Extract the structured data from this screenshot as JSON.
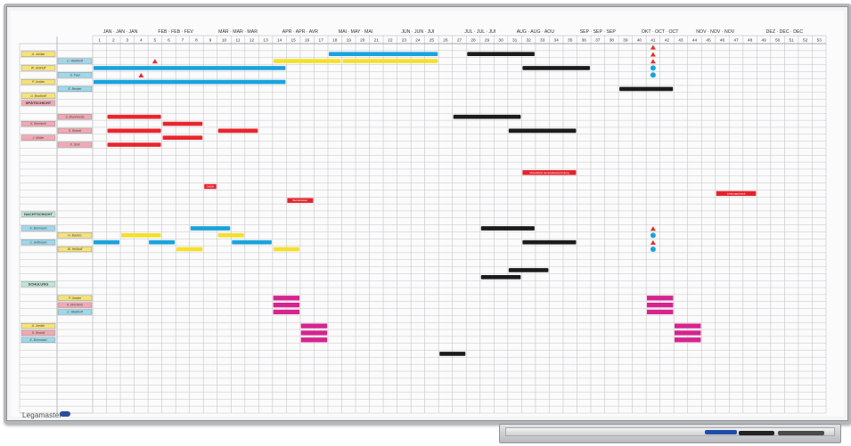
{
  "board": {
    "brand": "Legamaster",
    "frame_color": "#b5b7ba",
    "grid_color": "#c4c6c9",
    "text_color": "#333333"
  },
  "months": [
    "JAN · JAN · JAN",
    "FEB · FEB · FEV",
    "MÄR · MAR · MAR",
    "APR · APR · AVR",
    "MAI · MAY · MAI",
    "JUN · JUN · JUI",
    "JUL · JUL · JUI",
    "AUG · AUG · AOU",
    "SEP · SEP · SEP",
    "OKT · OCT · OCT",
    "NOV · NOV · NOV",
    "DEZ · DEC · DEC"
  ],
  "weeks": [
    "1",
    "2",
    "3",
    "4",
    "5",
    "6",
    "7",
    "8",
    "9",
    "10",
    "11",
    "12",
    "13",
    "14",
    "15",
    "16",
    "17",
    "18",
    "19",
    "20",
    "21",
    "22",
    "23",
    "24",
    "25",
    "26",
    "27",
    "28",
    "29",
    "30",
    "31",
    "32",
    "33",
    "34",
    "35",
    "36",
    "37",
    "38",
    "39",
    "40",
    "41",
    "42",
    "43",
    "44",
    "45",
    "46",
    "47",
    "48",
    "49",
    "50",
    "51",
    "52",
    "53"
  ],
  "section_labels": [
    {
      "text": "SPÄTSCHICHT",
      "color": "#f2a9b3",
      "row": 8
    },
    {
      "text": "NACHTSCHICHT",
      "color": "#bfe6d8",
      "row": 24
    },
    {
      "text": "SCHULUNG",
      "color": "#bfe6d8",
      "row": 34
    }
  ],
  "name_cards": [
    {
      "col": 0,
      "row": 1,
      "color": "#f6e27a",
      "text": "A. Jordan"
    },
    {
      "col": 1,
      "row": 2,
      "color": "#9ed8ea",
      "text": "C. Weidhoff"
    },
    {
      "col": 0,
      "row": 3,
      "color": "#f6e27a",
      "text": "W. Hellhoff"
    },
    {
      "col": 1,
      "row": 4,
      "color": "#9ed8ea",
      "text": "S. Paul"
    },
    {
      "col": 0,
      "row": 5,
      "color": "#f6e27a",
      "text": "P. Jordan"
    },
    {
      "col": 1,
      "row": 6,
      "color": "#9ed8ea",
      "text": "E. Bender"
    },
    {
      "col": 0,
      "row": 7,
      "color": "#f6e27a",
      "text": "U. Brodhoff"
    },
    {
      "col": 1,
      "row": 10,
      "color": "#f2a9b3",
      "text": "S. Brannwede"
    },
    {
      "col": 0,
      "row": 11,
      "color": "#f2a9b3",
      "text": "K. Bremmel"
    },
    {
      "col": 1,
      "row": 12,
      "color": "#f2a9b3",
      "text": "S. Brandt"
    },
    {
      "col": 0,
      "row": 13,
      "color": "#f2a9b3",
      "text": "J. Müller"
    },
    {
      "col": 1,
      "row": 14,
      "color": "#f2a9b3",
      "text": "K. Stoll"
    },
    {
      "col": 0,
      "row": 26,
      "color": "#9ed8ea",
      "text": "K. Borrmann"
    },
    {
      "col": 1,
      "row": 27,
      "color": "#f6e27a",
      "text": "H. Backes"
    },
    {
      "col": 0,
      "row": 28,
      "color": "#9ed8ea",
      "text": "C. Hoffmann"
    },
    {
      "col": 1,
      "row": 29,
      "color": "#f6e27a",
      "text": "W. Hellhoff"
    },
    {
      "col": 1,
      "row": 36,
      "color": "#f6e27a",
      "text": "P. Jordan"
    },
    {
      "col": 1,
      "row": 37,
      "color": "#f2a9b3",
      "text": "K. Bremmel"
    },
    {
      "col": 1,
      "row": 38,
      "color": "#9ed8ea",
      "text": "C. Weidhoff"
    },
    {
      "col": 0,
      "row": 40,
      "color": "#f6e27a",
      "text": "A. Jordan"
    },
    {
      "col": 0,
      "row": 41,
      "color": "#f2a9b3",
      "text": "S. Brandt"
    },
    {
      "col": 0,
      "row": 42,
      "color": "#9ed8ea",
      "text": "K. Borrmann"
    }
  ],
  "bars": [
    {
      "row": 1,
      "week_start": 18,
      "week_end": 25,
      "color": "#1aa3dd"
    },
    {
      "row": 1,
      "week_start": 28,
      "week_end": 32,
      "color": "#1b1b1b"
    },
    {
      "row": 2,
      "week_start": 14,
      "week_end": 18,
      "color": "#f5e02a"
    },
    {
      "row": 2,
      "week_start": 19,
      "week_end": 25,
      "color": "#f5e02a"
    },
    {
      "row": 3,
      "week_start": 1,
      "week_end": 14,
      "color": "#1aa3dd"
    },
    {
      "row": 3,
      "week_start": 32,
      "week_end": 36,
      "color": "#1b1b1b"
    },
    {
      "row": 5,
      "week_start": 1,
      "week_end": 14,
      "color": "#1aa3dd"
    },
    {
      "row": 6,
      "week_start": 39,
      "week_end": 42,
      "color": "#1b1b1b"
    },
    {
      "row": 10,
      "week_start": 2,
      "week_end": 5,
      "color": "#e8262e"
    },
    {
      "row": 10,
      "week_start": 27,
      "week_end": 31,
      "color": "#1b1b1b"
    },
    {
      "row": 11,
      "week_start": 6,
      "week_end": 8,
      "color": "#e8262e"
    },
    {
      "row": 12,
      "week_start": 2,
      "week_end": 5,
      "color": "#e8262e"
    },
    {
      "row": 12,
      "week_start": 10,
      "week_end": 12,
      "color": "#e8262e"
    },
    {
      "row": 12,
      "week_start": 31,
      "week_end": 35,
      "color": "#1b1b1b"
    },
    {
      "row": 13,
      "week_start": 6,
      "week_end": 8,
      "color": "#e8262e"
    },
    {
      "row": 14,
      "week_start": 2,
      "week_end": 5,
      "color": "#e8262e"
    },
    {
      "row": 26,
      "week_start": 8,
      "week_end": 10,
      "color": "#1aa3dd"
    },
    {
      "row": 26,
      "week_start": 29,
      "week_end": 32,
      "color": "#1b1b1b"
    },
    {
      "row": 27,
      "week_start": 3,
      "week_end": 5,
      "color": "#f5e02a"
    },
    {
      "row": 27,
      "week_start": 10,
      "week_end": 11,
      "color": "#f5e02a"
    },
    {
      "row": 28,
      "week_start": 1,
      "week_end": 2,
      "color": "#1aa3dd"
    },
    {
      "row": 28,
      "week_start": 5,
      "week_end": 6,
      "color": "#1aa3dd"
    },
    {
      "row": 28,
      "week_start": 11,
      "week_end": 13,
      "color": "#1aa3dd"
    },
    {
      "row": 28,
      "week_start": 32,
      "week_end": 35,
      "color": "#1b1b1b"
    },
    {
      "row": 29,
      "week_start": 7,
      "week_end": 8,
      "color": "#f5e02a"
    },
    {
      "row": 29,
      "week_start": 14,
      "week_end": 15,
      "color": "#f5e02a"
    },
    {
      "row": 32,
      "week_start": 31,
      "week_end": 33,
      "color": "#1b1b1b"
    },
    {
      "row": 33,
      "week_start": 29,
      "week_end": 31,
      "color": "#1b1b1b"
    },
    {
      "row": 44,
      "week_start": 26,
      "week_end": 27,
      "color": "#1b1b1b"
    }
  ],
  "pink_blocks": [
    {
      "row": 36,
      "week_start": 14,
      "week_end": 15
    },
    {
      "row": 37,
      "week_start": 14,
      "week_end": 15
    },
    {
      "row": 38,
      "week_start": 14,
      "week_end": 15
    },
    {
      "row": 40,
      "week_start": 16,
      "week_end": 17
    },
    {
      "row": 41,
      "week_start": 16,
      "week_end": 17
    },
    {
      "row": 42,
      "week_start": 16,
      "week_end": 17
    },
    {
      "row": 36,
      "week_start": 41,
      "week_end": 42
    },
    {
      "row": 37,
      "week_start": 41,
      "week_end": 42
    },
    {
      "row": 38,
      "week_start": 41,
      "week_end": 42
    },
    {
      "row": 40,
      "week_start": 43,
      "week_end": 44
    },
    {
      "row": 41,
      "week_start": 43,
      "week_end": 44
    },
    {
      "row": 42,
      "week_start": 43,
      "week_end": 44
    }
  ],
  "event_labels": [
    {
      "row": 20,
      "week": 9,
      "span": 1,
      "text": "Ostlöh"
    },
    {
      "row": 22,
      "week": 15,
      "span": 2,
      "text": "Betriebsfeier"
    },
    {
      "row": 18,
      "week": 32,
      "span": 4,
      "text": "Monatsfest Generalversammlung"
    },
    {
      "row": 21,
      "week": 46,
      "span": 3,
      "text": "Leistungscheck"
    }
  ],
  "triangles": [
    {
      "row": 2,
      "week": 5
    },
    {
      "row": 4,
      "week": 4
    },
    {
      "row": 0,
      "week": 41
    },
    {
      "row": 1,
      "week": 41
    },
    {
      "row": 2,
      "week": 41
    },
    {
      "row": 26,
      "week": 41
    },
    {
      "row": 28,
      "week": 41
    }
  ],
  "dots": [
    {
      "row": 3,
      "week": 41
    },
    {
      "row": 4,
      "week": 41
    },
    {
      "row": 27,
      "week": 41
    },
    {
      "row": 29,
      "week": 41
    }
  ],
  "tray_items": [
    {
      "type": "marker",
      "color": "#1f4ea8"
    },
    {
      "type": "marker",
      "color": "#222222"
    },
    {
      "type": "eraser",
      "color": "#444444"
    }
  ]
}
